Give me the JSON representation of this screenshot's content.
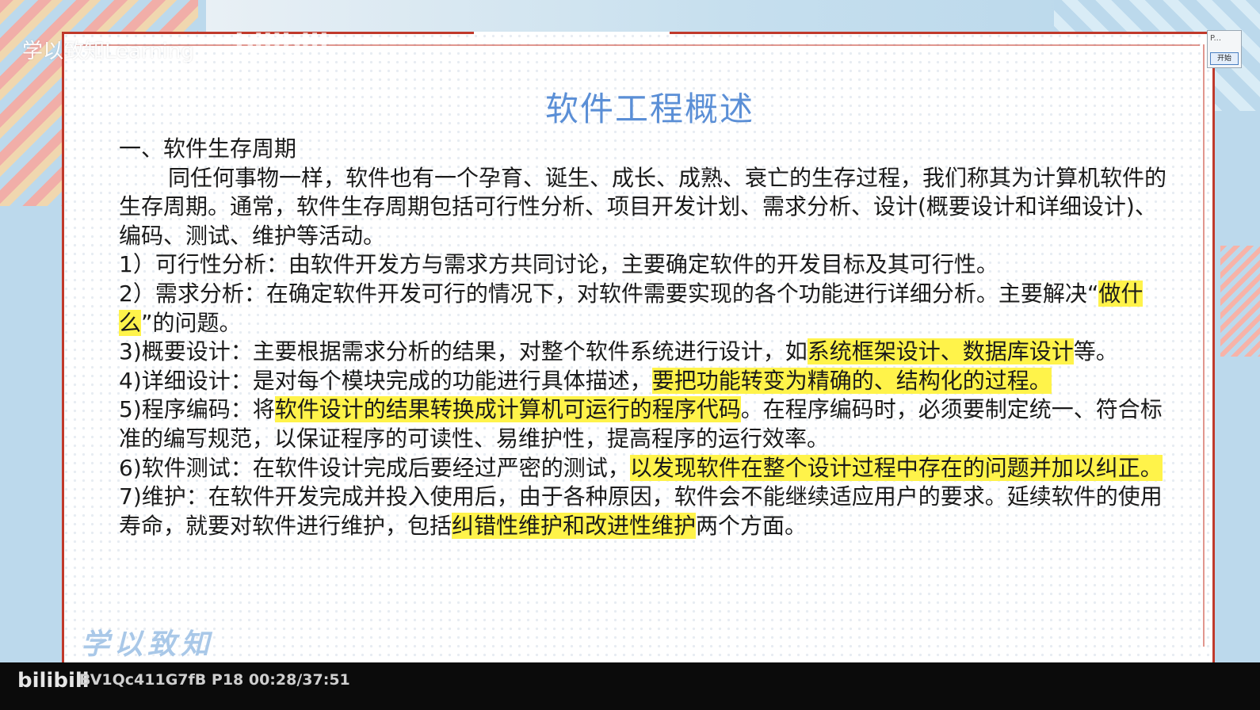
{
  "overlay": {
    "brand_text": "学以致知Learning",
    "bilibili_watermark": "bilibili",
    "script_logo": "学以致知"
  },
  "widget": {
    "label": "P...",
    "start_button": "开始"
  },
  "slide": {
    "title": "软件工程概述",
    "heading": "一、软件生存周期",
    "intro": "同任何事物一样，软件也有一个孕育、诞生、成长、成熟、衰亡的生存过程，我们称其为计算机软件的生存周期。通常，软件生存周期包括可行性分析、项目开发计划、需求分析、设计(概要设计和详细设计)、编码、测试、维护等活动。",
    "items": [
      {
        "pre": "1）可行性分析：由软件开发方与需求方共同讨论，主要确定软件的开发目标及其可行性。",
        "hl": "",
        "post": ""
      },
      {
        "pre": "2）需求分析：在确定软件开发可行的情况下，对软件需要实现的各个功能进行详细分析。主要解决“",
        "hl": "做什么",
        "post": "”的问题。"
      },
      {
        "pre": "3)概要设计：主要根据需求分析的结果，对整个软件系统进行设计，如",
        "hl": "系统框架设计、数据库设计",
        "post": "等。"
      },
      {
        "pre": "4)详细设计：是对每个模块完成的功能进行具体描述，",
        "hl": "要把功能转变为精确的、结构化的过程。",
        "post": ""
      },
      {
        "pre": "5)程序编码：将",
        "hl": "软件设计的结果转换成计算机可运行的程序代码",
        "post": "。在程序编码时，必须要制定统一、符合标准的编写规范，以保证程序的可读性、易维护性，提高程序的运行效率。"
      },
      {
        "pre": "6)软件测试：在软件设计完成后要经过严密的测试，",
        "hl": "以发现软件在整个设计过程中存在的问题并加以纠正。",
        "post": ""
      },
      {
        "pre": "7)维护：在软件开发完成并投入使用后，由于各种原因，软件会不能继续适应用户的要求。延续软件的使用寿命，就要对软件进行维护，包括",
        "hl": "纠错性维护和改进性维护",
        "post": "两个方面。"
      }
    ]
  },
  "player": {
    "logo": "bilibili",
    "info": "BV1Qc411G7fB P18 00:28/37:51"
  }
}
